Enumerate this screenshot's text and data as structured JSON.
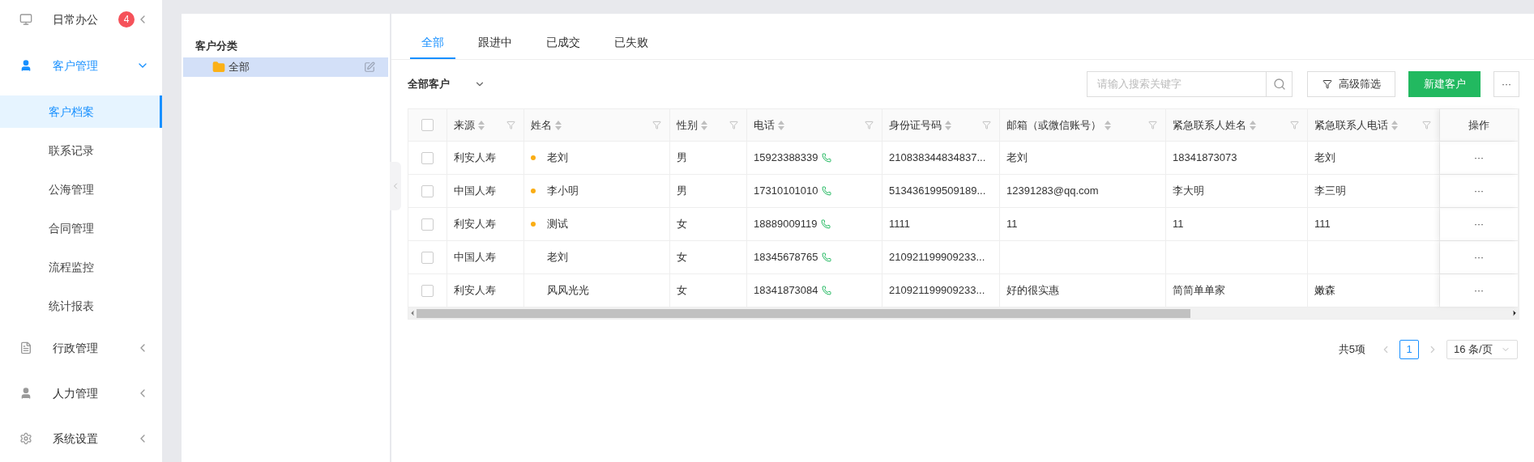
{
  "sidebar": {
    "items": [
      {
        "label": "日常办公",
        "badge": "4",
        "active": false,
        "expanded": false
      },
      {
        "label": "客户管理",
        "active": true,
        "expanded": true,
        "children": [
          {
            "label": "客户档案",
            "selected": true
          },
          {
            "label": "联系记录",
            "selected": false
          },
          {
            "label": "公海管理",
            "selected": false
          },
          {
            "label": "合同管理",
            "selected": false
          },
          {
            "label": "流程监控",
            "selected": false
          },
          {
            "label": "统计报表",
            "selected": false
          }
        ]
      },
      {
        "label": "行政管理",
        "active": false,
        "expanded": false
      },
      {
        "label": "人力管理",
        "active": false,
        "expanded": false
      },
      {
        "label": "系统设置",
        "active": false,
        "expanded": false
      }
    ]
  },
  "category_panel": {
    "title": "客户分类",
    "items": [
      {
        "label": "全部",
        "selected": true
      }
    ]
  },
  "tabs": [
    {
      "label": "全部",
      "selected": true
    },
    {
      "label": "跟进中",
      "selected": false
    },
    {
      "label": "已成交",
      "selected": false
    },
    {
      "label": "已失败",
      "selected": false
    }
  ],
  "toolbar": {
    "scope": "全部客户",
    "search": {
      "placeholder": "请输入搜索关键字"
    },
    "filter_button": "高级筛选",
    "create_button": "新建客户",
    "more_button": "···"
  },
  "table": {
    "select_all": {
      "checked": false
    },
    "columns": [
      {
        "label": "来源",
        "sortable": true,
        "filterable": true
      },
      {
        "label": "姓名",
        "sortable": true,
        "filterable": true
      },
      {
        "label": "性别",
        "sortable": true,
        "filterable": true
      },
      {
        "label": "电话",
        "sortable": true,
        "filterable": true
      },
      {
        "label": "身份证号码",
        "sortable": true,
        "filterable": true
      },
      {
        "label": "邮箱（或微信账号）",
        "sortable": true,
        "filterable": true
      },
      {
        "label": "紧急联系人姓名",
        "sortable": true,
        "filterable": true
      },
      {
        "label": "紧急联系人电话",
        "sortable": true,
        "filterable": true
      },
      {
        "label": "操作",
        "sortable": false,
        "filterable": false
      }
    ],
    "rows": [
      {
        "checked": false,
        "marked": true,
        "cells": [
          "利安人寿",
          "老刘",
          "男",
          "15923388339",
          "210838344834837...",
          "老刘",
          "18341873073",
          "老刘",
          "···"
        ]
      },
      {
        "checked": false,
        "marked": true,
        "cells": [
          "中国人寿",
          "李小明",
          "男",
          "17310101010",
          "513436199509189...",
          "12391283@qq.com",
          "李大明",
          "李三明",
          "···"
        ]
      },
      {
        "checked": false,
        "marked": true,
        "cells": [
          "利安人寿",
          "测试",
          "女",
          "18889009119",
          "1111",
          "11",
          "11",
          "111",
          "···"
        ]
      },
      {
        "checked": false,
        "marked": false,
        "cells": [
          "中国人寿",
          "老刘",
          "女",
          "18345678765",
          "210921199909233...",
          "",
          "",
          "",
          "···"
        ]
      },
      {
        "checked": false,
        "marked": false,
        "cells": [
          "利安人寿",
          "风风光光",
          "女",
          "18341873084",
          "210921199909233...",
          "好的很实惠",
          "简简单单家",
          "嫩森",
          "···"
        ]
      }
    ]
  },
  "pagination": {
    "total": "共5项",
    "pages": [
      {
        "label": "1",
        "selected": true
      }
    ],
    "page_size": "16 条/页"
  }
}
